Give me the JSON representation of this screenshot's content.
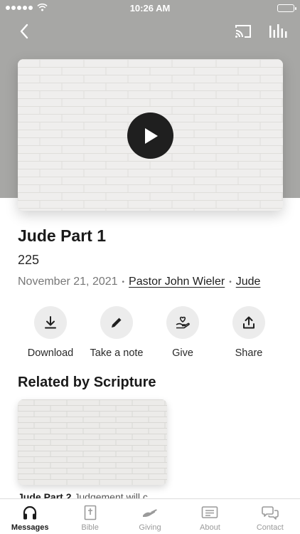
{
  "status_bar": {
    "time": "10:26 AM"
  },
  "video": {
    "play_label": "Play"
  },
  "sermon": {
    "title": "Jude Part 1",
    "views": "225",
    "date": "November 21, 2021",
    "speaker": "Pastor John Wieler",
    "series": "Jude",
    "separator": "•"
  },
  "actions": [
    {
      "label": "Download",
      "icon": "download-icon"
    },
    {
      "label": "Take a note",
      "icon": "pencil-icon"
    },
    {
      "label": "Give",
      "icon": "hand-heart-icon"
    },
    {
      "label": "Share",
      "icon": "share-icon"
    }
  ],
  "related": {
    "heading": "Related by Scripture",
    "items": [
      {
        "title": "Jude Part 2",
        "subtitle": "Judgement will c"
      }
    ]
  },
  "tabbar": {
    "items": [
      {
        "label": "Messages",
        "icon": "headphones-icon",
        "active": true
      },
      {
        "label": "Bible",
        "icon": "bible-icon",
        "active": false
      },
      {
        "label": "Giving",
        "icon": "giving-hand-icon",
        "active": false
      },
      {
        "label": "About",
        "icon": "about-card-icon",
        "active": false
      },
      {
        "label": "Contact",
        "icon": "chat-bubbles-icon",
        "active": false
      }
    ]
  },
  "colors": {
    "hero_background": "#a7a7a5",
    "play_button": "#1f1f1f",
    "action_circle": "#ececec"
  }
}
